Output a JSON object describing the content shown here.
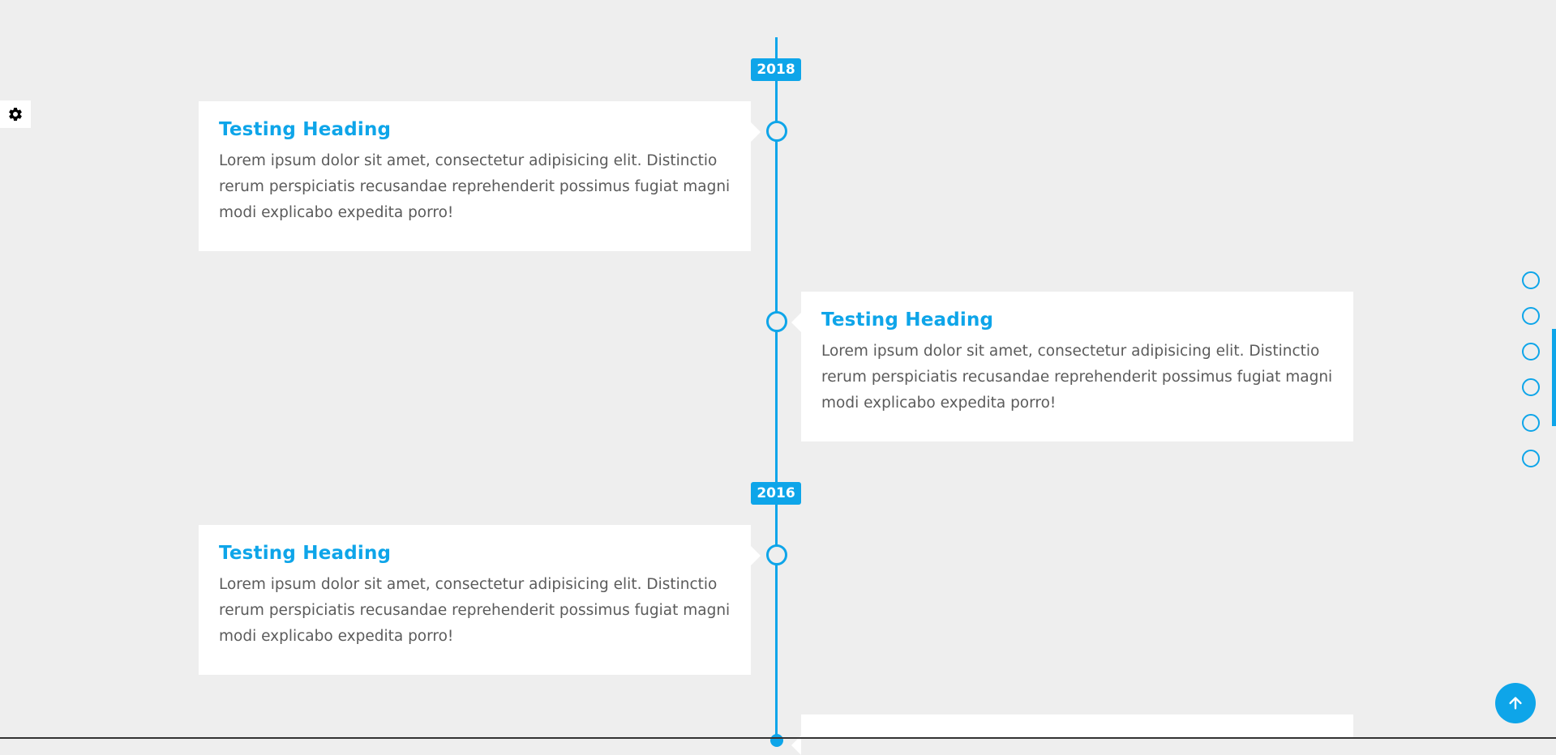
{
  "settings": {
    "icon": "gear-icon"
  },
  "timeline": {
    "years": [
      "2018",
      "2016"
    ],
    "entries": [
      {
        "heading": "Testing Heading",
        "body": "Lorem ipsum dolor sit amet, consectetur adipisicing elit. Distinctio rerum perspiciatis recusandae reprehenderit possimus fugiat magni modi explicabo expedita porro!",
        "side": "left"
      },
      {
        "heading": "Testing Heading",
        "body": "Lorem ipsum dolor sit amet, consectetur adipisicing elit. Distinctio rerum perspiciatis recusandae reprehenderit possimus fugiat magni modi explicabo expedita porro!",
        "side": "right"
      },
      {
        "heading": "Testing Heading",
        "body": "Lorem ipsum dolor sit amet, consectetur adipisicing elit. Distinctio rerum perspiciatis recusandae reprehenderit possimus fugiat magni modi explicabo expedita porro!",
        "side": "left"
      }
    ]
  },
  "dot_nav": {
    "count": 6
  },
  "back_to_top": {
    "icon": "arrow-up-icon"
  },
  "colors": {
    "accent": "#0ea5e9",
    "background": "#eeeeee",
    "card": "#ffffff",
    "heading": "#0ea5e9",
    "text": "#5b5b5b"
  }
}
